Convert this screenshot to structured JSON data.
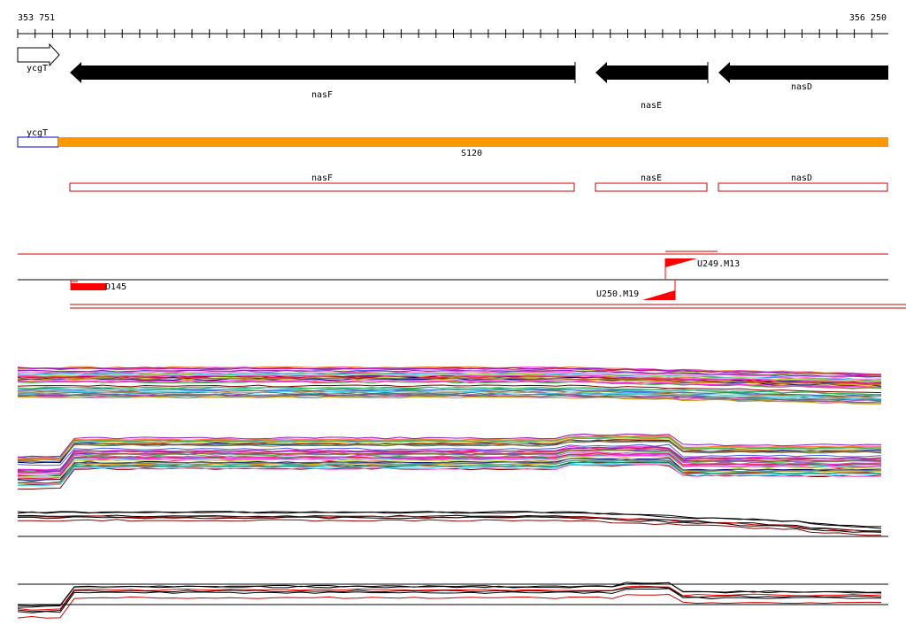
{
  "ruler": {
    "start_label": "353 751",
    "end_label": "356 250"
  },
  "genes": {
    "ycgT": "ycgT",
    "nasF": "nasF",
    "nasE": "nasE",
    "nasD": "nasD"
  },
  "transcripts": {
    "ycgT": "ycgT",
    "s120": "S120"
  },
  "cds": {
    "nasF": "nasF",
    "nasE": "nasE",
    "nasD": "nasD"
  },
  "features": {
    "d145": "D145",
    "u249": "U249.M13",
    "u250": "U250.M19"
  },
  "colors": {
    "gene": "#000000",
    "transcript": "#ff9900",
    "transcript_outline": "#0000cc",
    "cds_outline": "#cc0000",
    "feature": "#ff0000"
  }
}
